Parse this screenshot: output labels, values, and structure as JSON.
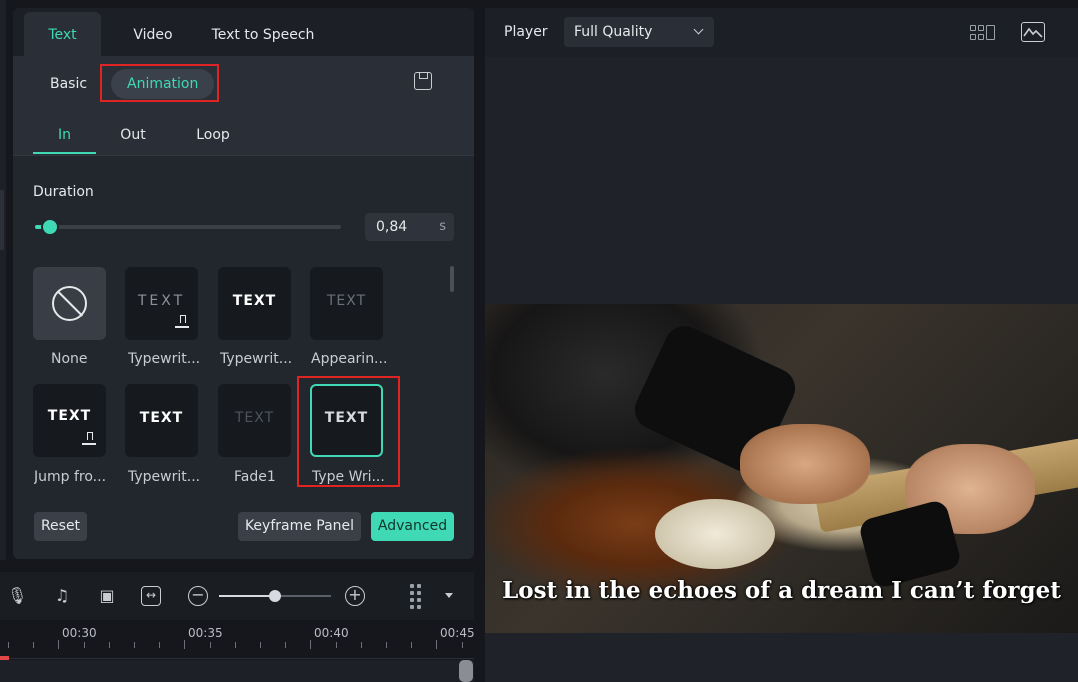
{
  "panel": {
    "tabs": [
      "Text",
      "Video",
      "Text to Speech"
    ],
    "subtabs": {
      "basic": "Basic",
      "animation": "Animation"
    },
    "anim_tabs": [
      "In",
      "Out",
      "Loop"
    ],
    "duration": {
      "label": "Duration",
      "value": "0,84",
      "unit": "s",
      "slider_fraction": 0.05
    },
    "presets": [
      {
        "label": "None",
        "preview": "",
        "downloadable": false,
        "selected": false
      },
      {
        "label": "Typewrit...",
        "preview": "TEXT",
        "downloadable": true,
        "selected": false
      },
      {
        "label": "Typewrit...",
        "preview": "TEXT",
        "downloadable": false,
        "selected": false
      },
      {
        "label": "Appearin...",
        "preview": "TEXT",
        "downloadable": false,
        "selected": false
      },
      {
        "label": "Jump fro...",
        "preview": "TEXT",
        "downloadable": true,
        "selected": false
      },
      {
        "label": "Typewrit...",
        "preview": "TEXT",
        "downloadable": false,
        "selected": false
      },
      {
        "label": "Fade1",
        "preview": "TEXT",
        "downloadable": false,
        "selected": false
      },
      {
        "label": "Type Wri...",
        "preview": "TEXT",
        "downloadable": false,
        "selected": true
      }
    ],
    "buttons": {
      "reset": "Reset",
      "keyframe": "Keyframe Panel",
      "advanced": "Advanced"
    }
  },
  "player": {
    "label": "Player",
    "quality": "Full Quality",
    "caption": "Lost in the echoes of a dream I can’t forget"
  },
  "timeline": {
    "zoom_fraction": 0.5,
    "ruler": [
      "00:30",
      "00:35",
      "00:40",
      "00:45"
    ]
  },
  "colors": {
    "accent": "#3fd9b5",
    "highlight": "#e02424",
    "playhead": "#e04848"
  }
}
